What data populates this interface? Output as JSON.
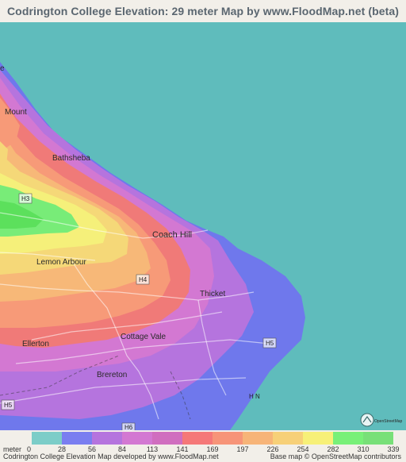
{
  "title": "Codrington College Elevation: 29 meter Map by www.FloodMap.net (beta)",
  "places": {
    "mount": "Mount",
    "bathsheba": "Bathsheba",
    "coach_hill": "Coach Hill",
    "lemon_arbour": "Lemon Arbour",
    "thicket": "Thicket",
    "ellerton": "Ellerton",
    "cottage_vale": "Cottage Vale",
    "brereton": "Brereton",
    "partial_e": "e"
  },
  "roads": {
    "h3": "H3",
    "h4": "H4",
    "h5_east": "H5",
    "h5_west": "H5",
    "h6": "H6",
    "hn": "H N"
  },
  "legend": {
    "unit": "meter",
    "ticks": [
      "0",
      "28",
      "56",
      "84",
      "113",
      "141",
      "169",
      "197",
      "226",
      "254",
      "282",
      "310",
      "339"
    ],
    "colors": [
      "#7ccdc8",
      "#7a7ef0",
      "#b574de",
      "#d378d2",
      "#d06ebf",
      "#f57878",
      "#f79478",
      "#f7b478",
      "#f7d078",
      "#f7f078",
      "#78f078",
      "#78e078"
    ]
  },
  "footer": {
    "left": "Codrington College Elevation Map developed by www.FloodMap.net",
    "right": "Base map © OpenStreetMap contributors"
  },
  "osm_logo_text": "OpenStreetMap"
}
